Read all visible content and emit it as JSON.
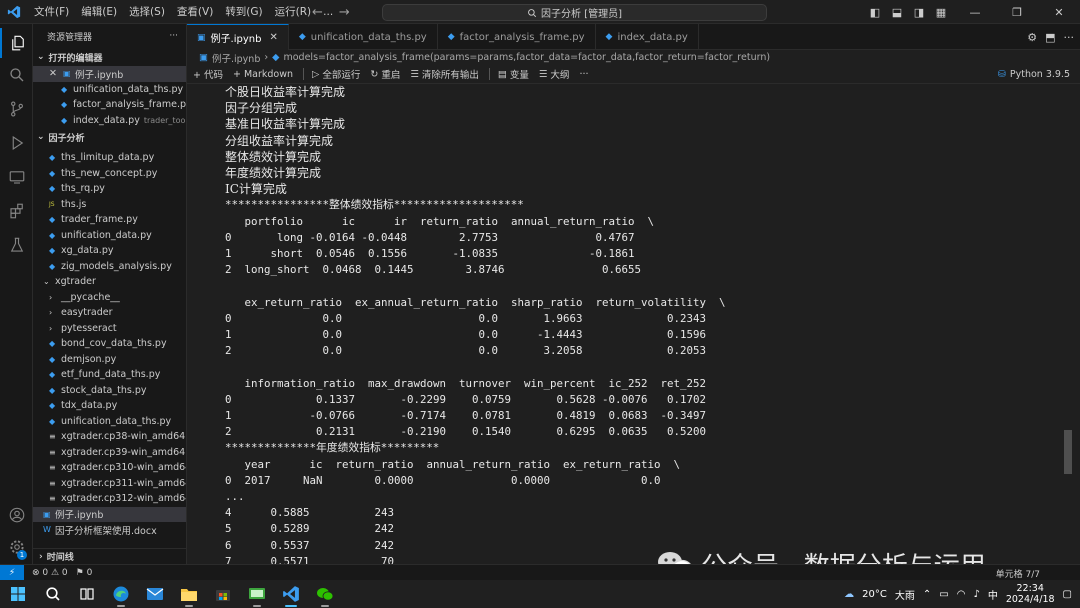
{
  "titlebar": {
    "logo": "VS Code",
    "menu": [
      "文件(F)",
      "编辑(E)",
      "选择(S)",
      "查看(V)",
      "转到(G)",
      "运行(R)",
      "..."
    ],
    "command_center": "因子分析 [管理员]",
    "nav_back": "←",
    "nav_forward": "→"
  },
  "sidebar": {
    "title": "资源管理器",
    "open_editors_label": "打开的编辑器",
    "open_editors": [
      {
        "name": "例子.ipynb",
        "hint": "",
        "selected": true
      },
      {
        "name": "unification_data_ths.py",
        "hint": "x..."
      },
      {
        "name": "factor_analysis_frame.py...",
        "hint": ""
      },
      {
        "name": "index_data.py",
        "hint": "trader_tool"
      }
    ],
    "project_label": "因子分析",
    "files": [
      {
        "name": "ths_limitup_data.py",
        "type": "py",
        "indent": 1
      },
      {
        "name": "ths_new_concept.py",
        "type": "py",
        "indent": 1
      },
      {
        "name": "ths_rq.py",
        "type": "py",
        "indent": 1
      },
      {
        "name": "ths.js",
        "type": "js",
        "indent": 1
      },
      {
        "name": "trader_frame.py",
        "type": "py",
        "indent": 1
      },
      {
        "name": "unification_data.py",
        "type": "py",
        "indent": 1
      },
      {
        "name": "xg_data.py",
        "type": "py",
        "indent": 1
      },
      {
        "name": "zig_models_analysis.py",
        "type": "py",
        "indent": 1
      },
      {
        "name": "xgtrader",
        "type": "folder-open",
        "indent": 0
      },
      {
        "name": "__pycache__",
        "type": "folder",
        "indent": 1
      },
      {
        "name": "easytrader",
        "type": "folder",
        "indent": 1
      },
      {
        "name": "pytesseract",
        "type": "folder",
        "indent": 1
      },
      {
        "name": "bond_cov_data_ths.py",
        "type": "py",
        "indent": 1
      },
      {
        "name": "demjson.py",
        "type": "py",
        "indent": 1
      },
      {
        "name": "etf_fund_data_ths.py",
        "type": "py",
        "indent": 1
      },
      {
        "name": "stock_data_ths.py",
        "type": "py",
        "indent": 1
      },
      {
        "name": "tdx_data.py",
        "type": "py",
        "indent": 1
      },
      {
        "name": "unification_data_ths.py",
        "type": "py",
        "indent": 1
      },
      {
        "name": "xgtrader.cp38-win_amd64.pyd",
        "type": "pyd",
        "indent": 1
      },
      {
        "name": "xgtrader.cp39-win_amd64.pyd",
        "type": "pyd",
        "indent": 1
      },
      {
        "name": "xgtrader.cp310-win_amd64....",
        "type": "pyd",
        "indent": 1
      },
      {
        "name": "xgtrader.cp311-win_amd64....",
        "type": "pyd",
        "indent": 1
      },
      {
        "name": "xgtrader.cp312-win_amd64....",
        "type": "pyd",
        "indent": 1
      },
      {
        "name": "例子.ipynb",
        "type": "nb",
        "indent": 0,
        "selected": true
      },
      {
        "name": "因子分析框架使用.docx",
        "type": "doc",
        "indent": 0
      }
    ],
    "timeline_label": "时间线"
  },
  "tabs": [
    {
      "label": "例子.ipynb",
      "active": true
    },
    {
      "label": "unification_data_ths.py"
    },
    {
      "label": "factor_analysis_frame.py"
    },
    {
      "label": "index_data.py"
    }
  ],
  "breadcrumb": {
    "file": "例子.ipynb",
    "cell": "models=factor_analysis_frame(params=params,factor_data=factor_data,factor_return=factor_return)"
  },
  "toolbar": {
    "code": "+ 代码",
    "markdown": "+ Markdown",
    "run_all": "全部运行",
    "restart": "重启",
    "clear": "清除所有输出",
    "variables": "变量",
    "outline": "大纲",
    "more": "···",
    "kernel": "Python 3.9.5"
  },
  "output": {
    "cn_lines": [
      "个股日收益率计算完成",
      "因子分组完成",
      "基准日收益率计算完成",
      "分组收益率计算完成",
      "整体绩效计算完成",
      "年度绩效计算完成",
      "IC计算完成"
    ],
    "lines": [
      "****************整体绩效指标********************",
      "   portfolio      ic      ir  return_ratio  annual_return_ratio  \\",
      "0       long -0.0164 -0.0448        2.7753               0.4767",
      "1      short  0.0546  0.1556       -1.0835              -0.1861",
      "2  long_short  0.0468  0.1445        3.8746               0.6655",
      "",
      "   ex_return_ratio  ex_annual_return_ratio  sharp_ratio  return_volatility  \\",
      "0              0.0                     0.0       1.9663             0.2343",
      "1              0.0                     0.0      -1.4443             0.1596",
      "2              0.0                     0.0       3.2058             0.2053",
      "",
      "   information_ratio  max_drawdown  turnover  win_percent  ic_252  ret_252",
      "0             0.1337       -0.2299    0.0759       0.5628 -0.0076   0.1702",
      "1            -0.0766       -0.7174    0.0781       0.4819  0.0683  -0.3497",
      "2             0.2131       -0.2190    0.1540       0.6295  0.0635   0.5200",
      "**************年度绩效指标*********",
      "   year      ic  return_ratio  annual_return_ratio  ex_return_ratio  \\",
      "0  2017     NaN        0.0000               0.0000              0.0",
      "...",
      "4      0.5885          243",
      "5      0.5289          242",
      "6      0.5537          242",
      "7      0.5571           70"
    ]
  },
  "watermark": "公众号 · 数据分析与运用",
  "statusbar": {
    "remote": "⚡",
    "problems": "⊗ 0 ⚠ 0",
    "ports": "⚑ 0",
    "cell_pos": "单元格 7/7"
  },
  "taskbar": {
    "weather_temp": "20°C",
    "weather_text": "大雨",
    "ime": "中",
    "time": "22:34",
    "date": "2024/4/18"
  },
  "colors": {
    "accent": "#0078d4",
    "python_icon": "#3c9df0",
    "background": "#1f1f1f"
  }
}
